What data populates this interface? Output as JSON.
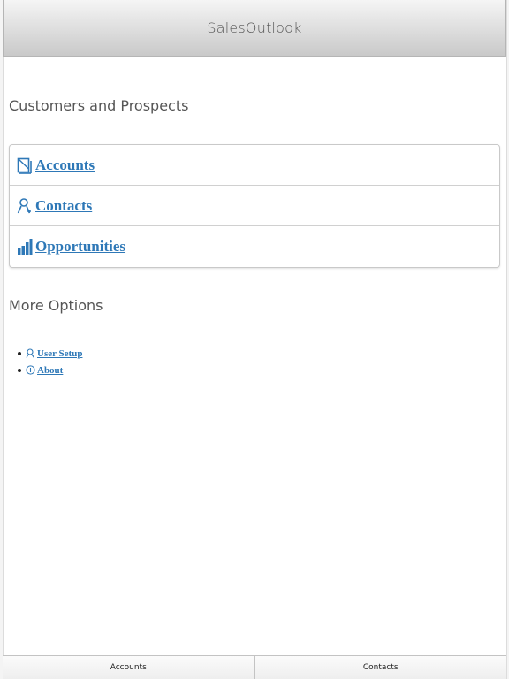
{
  "header": {
    "title": "SalesOutlook"
  },
  "sections": {
    "customers_title": "Customers and Prospects",
    "more_title": "More Options"
  },
  "menu": {
    "items": [
      {
        "label": "Accounts",
        "icon": "accounts-icon"
      },
      {
        "label": "Contacts",
        "icon": "contact-person-icon"
      },
      {
        "label": "Opportunities",
        "icon": "bar-chart-icon"
      }
    ]
  },
  "options": {
    "items": [
      {
        "label": "User Setup",
        "icon": "user-setup-icon"
      },
      {
        "label": "About",
        "icon": "info-icon"
      }
    ]
  },
  "bottom_nav": {
    "tabs": [
      {
        "label": "Accounts"
      },
      {
        "label": "Contacts"
      }
    ]
  },
  "colors": {
    "link": "#2e78b7",
    "header_top": "#f5f5f5",
    "header_bottom": "#c9c9c9",
    "text_muted": "#555555"
  }
}
